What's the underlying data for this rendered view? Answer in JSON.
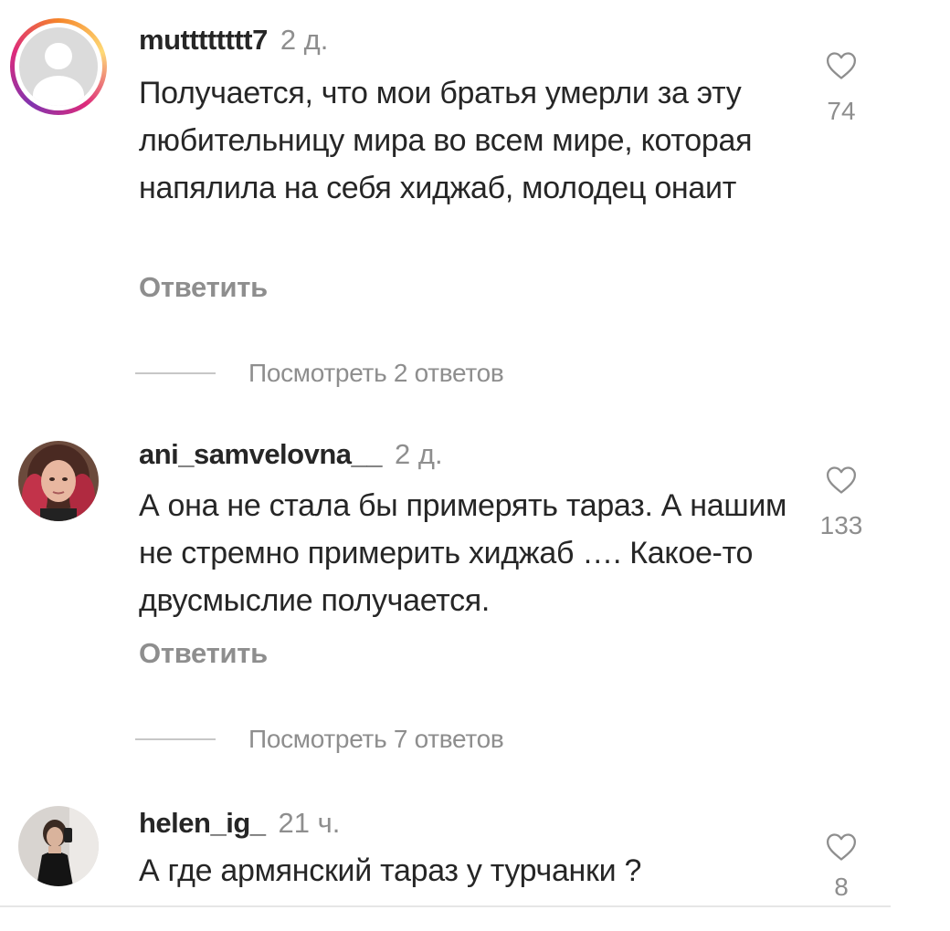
{
  "comments": [
    {
      "username": "mutttttttt7",
      "time": "2 д.",
      "text": "Получается, что мои братья умерли за эту любительницу мира во всем мире, которая напялила на себя хиджаб, молодец онаит",
      "reply_label": "Ответить",
      "likes": "74",
      "view_replies": "Посмотреть 2 ответов"
    },
    {
      "username": "ani_samvelovna__",
      "time": "2 д.",
      "text": "А она не стала бы примерять тараз. А нашим не стремно примерить хиджаб …. Какое-то двусмыслие получается.",
      "reply_label": "Ответить",
      "likes": "133",
      "view_replies": "Посмотреть 7 ответов"
    },
    {
      "username": "helen_ig_",
      "time": "21 ч.",
      "text": "А где армянский тараз у турчанки ?",
      "likes": "8"
    }
  ],
  "icons": {
    "like": "heart-outline-icon",
    "default_avatar": "default-avatar-icon"
  },
  "colors": {
    "primary_text": "#262626",
    "secondary_text": "#8e8e8e",
    "divider": "#c7c7c7"
  }
}
